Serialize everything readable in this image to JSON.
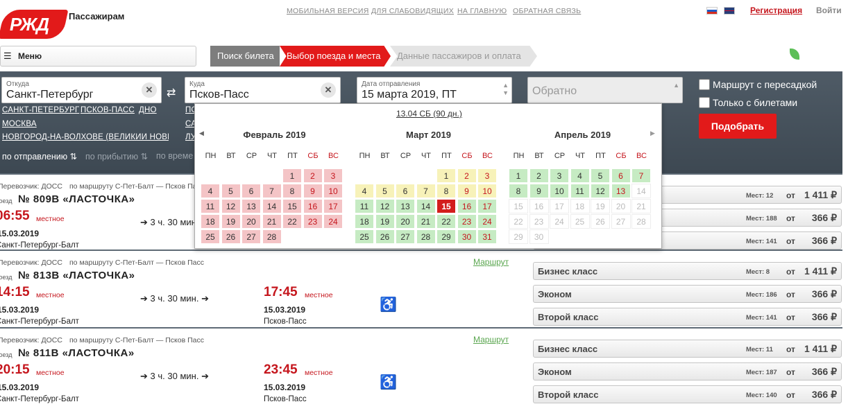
{
  "header": {
    "logo_text": "РЖД",
    "brand": "Пассажирам",
    "links": [
      "МОБИЛЬНАЯ ВЕРСИЯ",
      "ДЛЯ СЛАБОВИДЯЩИХ",
      "НА ГЛАВНУЮ",
      "ОБРАТНАЯ СВЯЗЬ"
    ],
    "register": "Регистрация",
    "login": "Войти"
  },
  "menu": {
    "label": "Меню",
    "icon": "hamburger-icon"
  },
  "steps": [
    "Поиск билета",
    "Выбор поезда и места",
    "Данные пассажиров и оплата"
  ],
  "search": {
    "from": {
      "label": "Откуда",
      "value": "Санкт-Петербург"
    },
    "to": {
      "label": "Куда",
      "value": "Псков-Пасс"
    },
    "date": {
      "label": "Дата отправления",
      "value": "15 марта 2019, ПТ"
    },
    "return_placeholder": "Обратно",
    "transfer_label": "Маршрут с пересадкой",
    "tickets_only_label": "Только с билетами",
    "submit": "Подобрать",
    "from_suggestions": [
      "САНКТ-ПЕТЕРБУРГ",
      "ПСКОВ-ПАСС",
      "ДНО",
      "МОСКВА",
      "НОВГОРОД-НА-ВОЛХОВЕ (ВЕЛИКИЙ НОВГ"
    ],
    "to_suggestions": [
      "ПО",
      "СА",
      "ЛУ"
    ],
    "sort": {
      "departure": "по отправлению",
      "arrival": "по прибытию",
      "time": "по време"
    }
  },
  "calendar": {
    "limit": "13.04 СБ (90 дн.)",
    "weekdays": [
      "ПН",
      "ВТ",
      "СР",
      "ЧТ",
      "ПТ",
      "СБ",
      "ВС"
    ],
    "months": [
      {
        "title": "Февраль 2019",
        "offset": 4,
        "days": 28
      },
      {
        "title": "Март 2019",
        "offset": 4,
        "days": 31,
        "selected": 15
      },
      {
        "title": "Апрель 2019",
        "offset": 0,
        "days": 30
      }
    ]
  },
  "trains": [
    {
      "carrier": "Перевозчик: ДОСС",
      "route": "по маршруту С-Пет-Балт — Псков Пасс",
      "route_link": "",
      "type": "Поезд",
      "number": "№ 809В «ЛАСТОЧКА»",
      "dep_time": "06:55",
      "dep_note": "местное",
      "dep_date": "15.03.2019",
      "dep_station": "Санкт-Петербург-Балт",
      "duration": "3 ч. 30 мин.",
      "arr_time": "",
      "arr_note": "",
      "arr_date": "",
      "arr_station": "",
      "classes": [
        {
          "name": "",
          "seats": "Мест: 12",
          "from": "от",
          "price": "1 411 ₽"
        },
        {
          "name": "",
          "seats": "Мест: 188",
          "from": "от",
          "price": "366 ₽"
        },
        {
          "name": "",
          "seats": "Мест: 141",
          "from": "от",
          "price": "366 ₽"
        }
      ]
    },
    {
      "carrier": "Перевозчик: ДОСС",
      "route": "по маршруту С-Пет-Балт — Псков Пасс",
      "route_link": "Маршрут",
      "type": "Поезд",
      "number": "№ 813В «ЛАСТОЧКА»",
      "dep_time": "14:15",
      "dep_note": "местное",
      "dep_date": "15.03.2019",
      "dep_station": "Санкт-Петербург-Балт",
      "duration": "3 ч. 30 мин.",
      "arr_time": "17:45",
      "arr_note": "местное",
      "arr_date": "15.03.2019",
      "arr_station": "Псков-Пасс",
      "classes": [
        {
          "name": "Бизнес класс",
          "seats": "Мест: 8",
          "from": "от",
          "price": "1 411 ₽"
        },
        {
          "name": "Эконом",
          "seats": "Мест: 186",
          "from": "от",
          "price": "366 ₽"
        },
        {
          "name": "Второй класс",
          "seats": "Мест: 141",
          "from": "от",
          "price": "366 ₽"
        }
      ]
    },
    {
      "carrier": "Перевозчик: ДОСС",
      "route": "по маршруту С-Пет-Балт — Псков Пасс",
      "route_link": "Маршрут",
      "type": "Поезд",
      "number": "№ 811В «ЛАСТОЧКА»",
      "dep_time": "20:15",
      "dep_note": "местное",
      "dep_date": "15.03.2019",
      "dep_station": "Санкт-Петербург-Балт",
      "duration": "3 ч. 30 мин.",
      "arr_time": "23:45",
      "arr_note": "местное",
      "arr_date": "15.03.2019",
      "arr_station": "Псков-Пасс",
      "classes": [
        {
          "name": "Бизнес класс",
          "seats": "Мест: 11",
          "from": "от",
          "price": "1 411 ₽"
        },
        {
          "name": "Эконом",
          "seats": "Мест: 187",
          "from": "от",
          "price": "366 ₽"
        },
        {
          "name": "Второй класс",
          "seats": "Мест: 140",
          "from": "от",
          "price": "366 ₽"
        }
      ]
    }
  ]
}
